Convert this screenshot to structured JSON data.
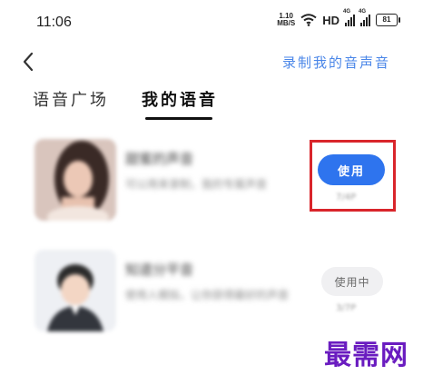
{
  "status_bar": {
    "time": "11:06",
    "net_speed_value": "1.10",
    "net_speed_unit": "MB/S",
    "hd_label": "HD",
    "sim1_gen": "4G",
    "sim2_gen": "4G",
    "battery": "81"
  },
  "header": {
    "record_link": "录制我的音声音"
  },
  "tabs": [
    {
      "label": "语音广场",
      "active": false
    },
    {
      "label": "我的语音",
      "active": true
    }
  ],
  "voices": [
    {
      "name": "甜蜜的声音",
      "description": "可以用来录制，我的专属声音",
      "count": "7/4P",
      "button_label": "使用"
    },
    {
      "name": "知道分平音",
      "description": "使用人模拟，让你获得最好的声音",
      "count": "3/7P",
      "button_label": "使用中"
    }
  ],
  "watermark": "最需网",
  "colors": {
    "accent": "#2e74ee",
    "link": "#4a86e8",
    "highlight": "#d9252b",
    "watermark": "#6a1cc0"
  }
}
